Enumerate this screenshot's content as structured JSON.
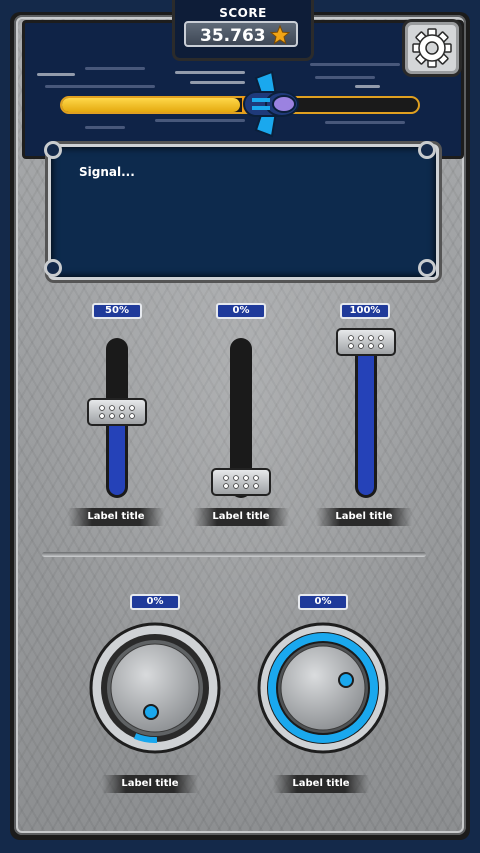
{
  "header": {
    "score_label": "SCORE",
    "score_value": "35.763",
    "progress": 0.5
  },
  "screen": {
    "text": "Signal..."
  },
  "sliders": [
    {
      "value_label": "50%",
      "value": 0.5,
      "label": "Label title"
    },
    {
      "value_label": "0%",
      "value": 0.0,
      "label": "Label title"
    },
    {
      "value_label": "100%",
      "value": 1.0,
      "label": "Label title"
    }
  ],
  "knobs": [
    {
      "value_label": "0%",
      "label": "Label title",
      "style": "dark"
    },
    {
      "value_label": "0%",
      "label": "Label title",
      "style": "glow"
    }
  ],
  "colors": {
    "accent_blue": "#2542b8",
    "glow_blue": "#1aa8ee",
    "gold": "#e4a90f"
  },
  "icons": [
    "star-icon",
    "gear-icon",
    "spaceship-icon"
  ]
}
